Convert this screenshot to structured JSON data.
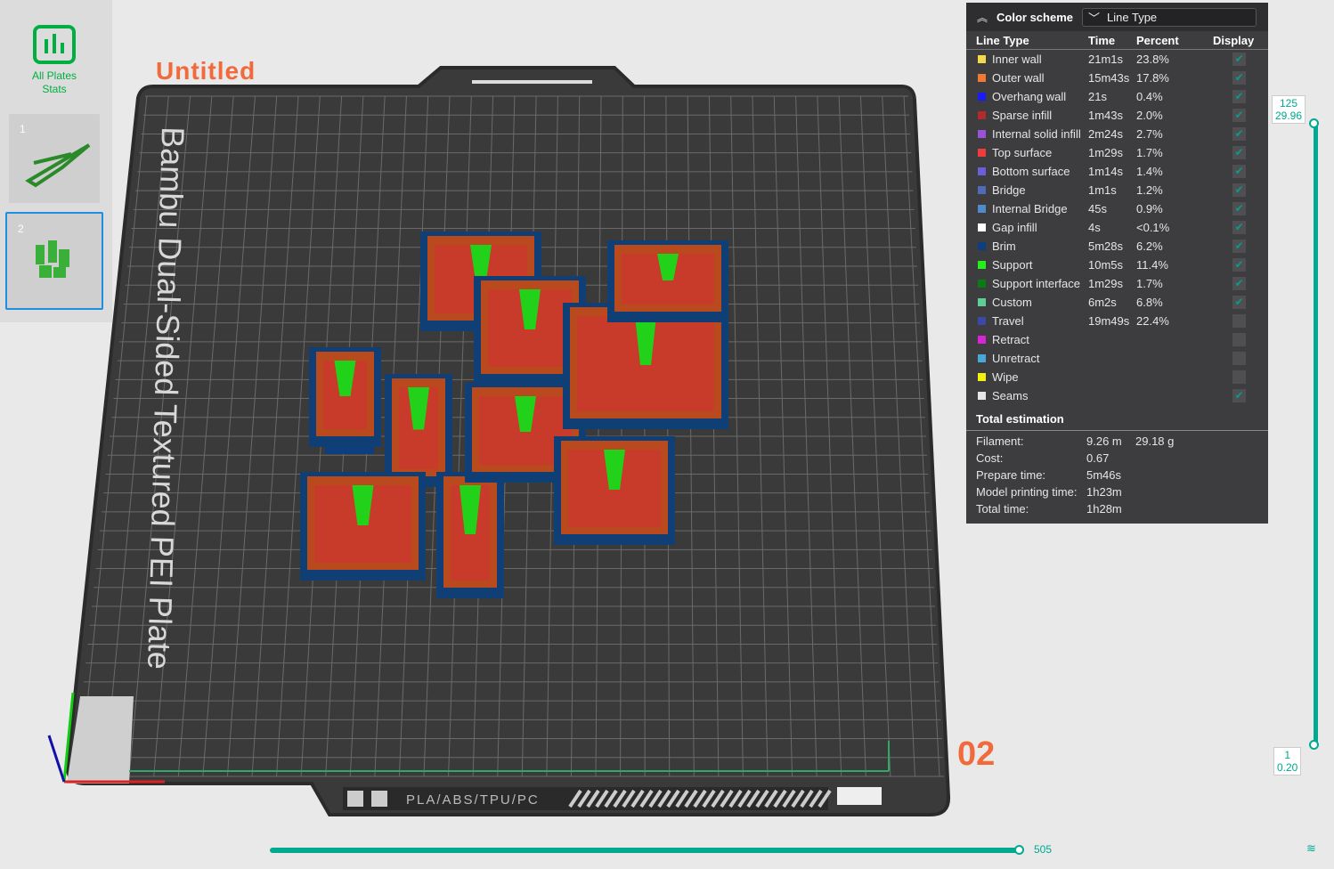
{
  "sidebar": {
    "stats_label_1": "All Plates",
    "stats_label_2": "Stats",
    "plates": [
      {
        "num": "1"
      },
      {
        "num": "2",
        "selected": true
      }
    ]
  },
  "viewport": {
    "project_title": "Untitled",
    "plate_number": "02",
    "bed_label": "Bambu Dual-Sided Textured PEI Plate",
    "bed_materials": "PLA/ABS/TPU/PC"
  },
  "panel": {
    "color_scheme_label": "Color scheme",
    "color_scheme_value": "Line Type",
    "headers": {
      "type": "Line Type",
      "time": "Time",
      "percent": "Percent",
      "display": "Display"
    },
    "rows": [
      {
        "name": "Inner wall",
        "time": "21m1s",
        "percent": "23.8%",
        "color": "#f5d94a",
        "display": true
      },
      {
        "name": "Outer wall",
        "time": "15m43s",
        "percent": "17.8%",
        "color": "#f07a35",
        "display": true
      },
      {
        "name": "Overhang wall",
        "time": "21s",
        "percent": "0.4%",
        "color": "#1a1aff",
        "display": true
      },
      {
        "name": "Sparse infill",
        "time": "1m43s",
        "percent": "2.0%",
        "color": "#b22a2a",
        "display": true
      },
      {
        "name": "Internal solid infill",
        "time": "2m24s",
        "percent": "2.7%",
        "color": "#9b52d6",
        "display": true
      },
      {
        "name": "Top surface",
        "time": "1m29s",
        "percent": "1.7%",
        "color": "#ef3b3b",
        "display": true
      },
      {
        "name": "Bottom surface",
        "time": "1m14s",
        "percent": "1.4%",
        "color": "#6a5fd6",
        "display": true
      },
      {
        "name": "Bridge",
        "time": "1m1s",
        "percent": "1.2%",
        "color": "#4f6bb5",
        "display": true
      },
      {
        "name": "Internal Bridge",
        "time": "45s",
        "percent": "0.9%",
        "color": "#4f8ac9",
        "display": true
      },
      {
        "name": "Gap infill",
        "time": "4s",
        "percent": "<0.1%",
        "color": "#ffffff",
        "display": true
      },
      {
        "name": "Brim",
        "time": "5m28s",
        "percent": "6.2%",
        "color": "#0d3f80",
        "display": true
      },
      {
        "name": "Support",
        "time": "10m5s",
        "percent": "11.4%",
        "color": "#22f21a",
        "display": true
      },
      {
        "name": "Support interface",
        "time": "1m29s",
        "percent": "1.7%",
        "color": "#0a7a12",
        "display": true
      },
      {
        "name": "Custom",
        "time": "6m2s",
        "percent": "6.8%",
        "color": "#5ecf94",
        "display": true
      },
      {
        "name": "Travel",
        "time": "19m49s",
        "percent": "22.4%",
        "color": "#3a48a8",
        "display": false
      },
      {
        "name": "Retract",
        "time": "",
        "percent": "",
        "color": "#d624d6",
        "display": false
      },
      {
        "name": "Unretract",
        "time": "",
        "percent": "",
        "color": "#4aa8d8",
        "display": false
      },
      {
        "name": "Wipe",
        "time": "",
        "percent": "",
        "color": "#f2f20a",
        "display": false
      },
      {
        "name": "Seams",
        "time": "",
        "percent": "",
        "color": "#e6e6e6",
        "display": true
      }
    ],
    "total_estimation": "Total estimation",
    "estimates": [
      {
        "k": "Filament:",
        "v": "9.26 m",
        "v2": "29.18 g"
      },
      {
        "k": "Cost:",
        "v": "0.67",
        "v2": ""
      },
      {
        "k": "Prepare time:",
        "v": "5m46s",
        "v2": ""
      },
      {
        "k": "Model printing time:",
        "v": "1h23m",
        "v2": ""
      },
      {
        "k": "Total time:",
        "v": "1h28m",
        "v2": ""
      }
    ]
  },
  "layer_slider": {
    "top_layer": "125",
    "top_height": "29.96",
    "bottom_layer": "1",
    "bottom_height": "0.20"
  },
  "move_slider": {
    "value": "505"
  },
  "accent_color": "#00a98f"
}
